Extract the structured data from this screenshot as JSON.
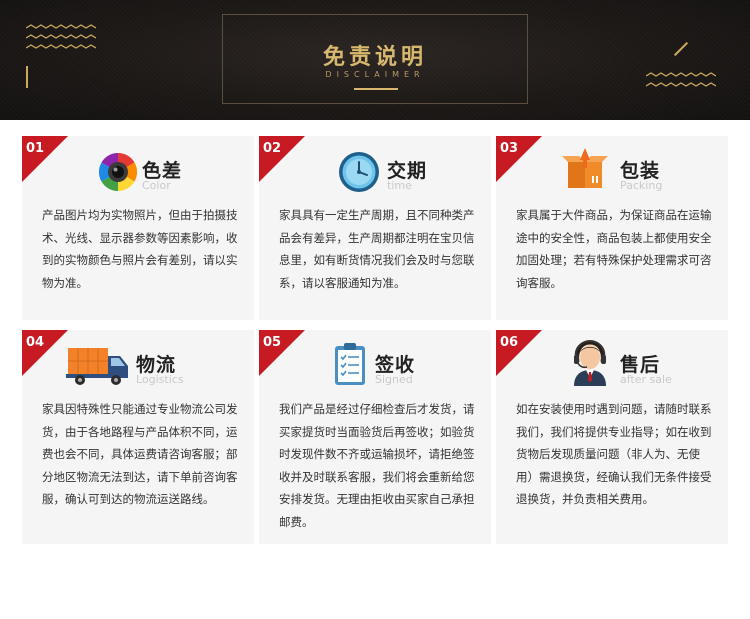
{
  "header": {
    "title": "免责说明",
    "subtitle": "DISCLAIMER"
  },
  "colors": {
    "accent_red": "#c81a22",
    "gold": "#d8b86f",
    "card_bg": "#f5f5f5"
  },
  "cards": [
    {
      "num": "01",
      "title": "色差",
      "subtitle": "Color",
      "icon": "camera-lens-icon",
      "body": "产品图片均为实物照片，但由于拍摄技术、光线、显示器参数等因素影响，收到的实物颜色与照片会有差别，请以实物为准。"
    },
    {
      "num": "02",
      "title": "交期",
      "subtitle": "time",
      "icon": "clock-icon",
      "body": "家具具有一定生产周期，且不同种类产品会有差异，生产周期都注明在宝贝信息里，如有断货情况我们会及时与您联系，请以客服通知为准。"
    },
    {
      "num": "03",
      "title": "包装",
      "subtitle": "Packing",
      "icon": "package-box-icon",
      "body": "家具属于大件商品，为保证商品在运输途中的安全性，商品包装上都使用安全加固处理；若有特殊保护处理需求可咨询客服。"
    },
    {
      "num": "04",
      "title": "物流",
      "subtitle": "Logistics",
      "icon": "delivery-truck-icon",
      "body": "家具因特殊性只能通过专业物流公司发货，由于各地路程与产品体积不同，运费也会不同，具体运费请咨询客服；部分地区物流无法到达，请下单前咨询客服，确认可到达的物流运送路线。"
    },
    {
      "num": "05",
      "title": "签收",
      "subtitle": "Signed",
      "icon": "clipboard-checklist-icon",
      "body": "我们产品是经过仔细检查后才发货，请买家提货时当面验货后再签收；如验货时发现件数不齐或运输损坏，请拒绝签收并及时联系客服，我们将会重新给您安排发货。无理由拒收由买家自己承担邮费。"
    },
    {
      "num": "06",
      "title": "售后",
      "subtitle": "after sale",
      "icon": "customer-service-headset-icon",
      "body": "如在安装使用时遇到问题，请随时联系我们，我们将提供专业指导；如在收到货物后发现质量问题（非人为、无使用）需退换货，经确认我们无条件接受退换货，并负责相关费用。"
    }
  ]
}
